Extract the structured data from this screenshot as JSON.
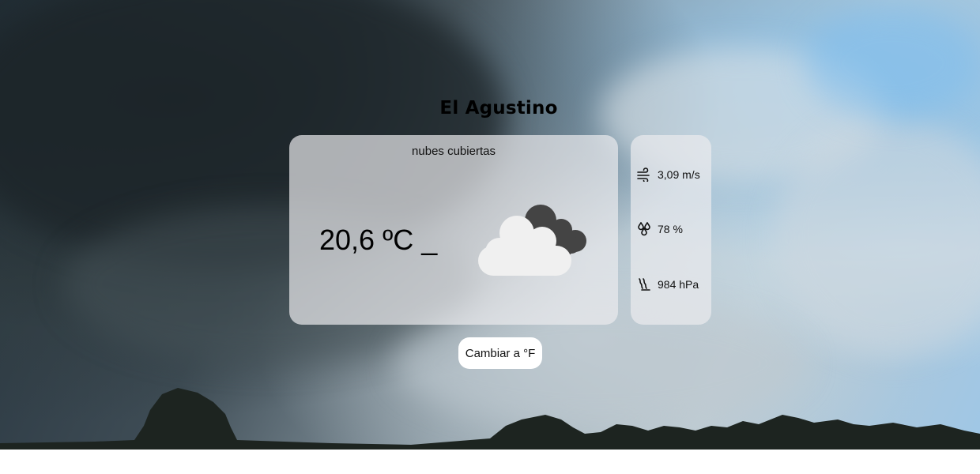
{
  "location": {
    "city": "El Agustino"
  },
  "current": {
    "description": "nubes cubiertas",
    "temperature_text": "20,6 ºC _",
    "icon": "overcast-clouds-icon"
  },
  "details": {
    "wind": {
      "icon": "wind-icon",
      "value": "3,09 m/s"
    },
    "humidity": {
      "icon": "humidity-icon",
      "value": "78 %"
    },
    "pressure": {
      "icon": "pressure-icon",
      "value": "984 hPa"
    }
  },
  "actions": {
    "toggle_units_label": "Cambiar a °F"
  },
  "colors": {
    "card_background": "#ebebee",
    "button_background": "#ffffff",
    "cloud_light": "#f0f0f0",
    "cloud_dark": "#444444"
  }
}
